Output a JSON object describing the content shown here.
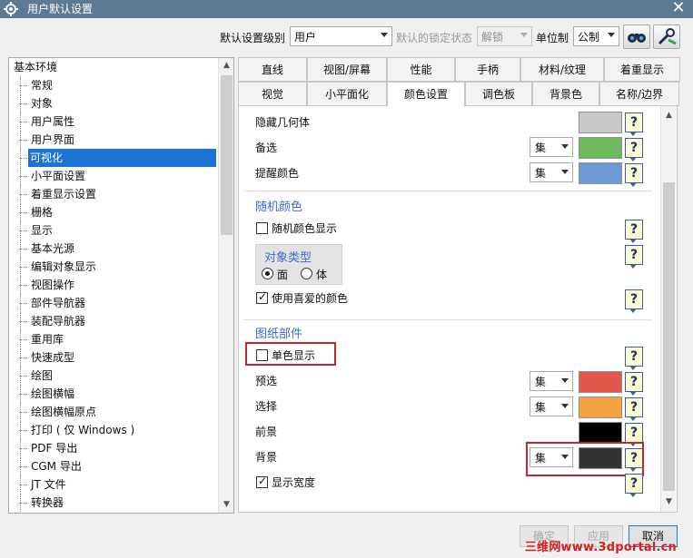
{
  "window": {
    "title": "用户默认设置",
    "close_glyph": "✕"
  },
  "toolbar": {
    "level_label": "默认设置级别",
    "level_value": "用户",
    "lock_label": "默认的锁定状态",
    "lock_value": "解锁",
    "unit_label": "单位制",
    "unit_value": "公制"
  },
  "tree": {
    "root": "基本环境",
    "items": [
      "常规",
      "对象",
      "用户属性",
      "用户界面",
      "可视化",
      "小平面设置",
      "着重显示设置",
      "栅格",
      "显示",
      "基本光源",
      "编辑对象显示",
      "视图操作",
      "部件导航器",
      "装配导航器",
      "重用库",
      "快速成型",
      "绘图",
      "绘图横幅",
      "绘图横幅原点",
      "打印 ( 仅 Windows )",
      "PDF 导出",
      "CGM 导出",
      "JT 文件",
      "转换器"
    ],
    "selected_index": 4
  },
  "tabs": {
    "row1": [
      "直线",
      "视图/屏幕",
      "性能",
      "手柄",
      "材料/纹理",
      "着重显示"
    ],
    "row2": [
      "视觉",
      "小平面化",
      "颜色设置",
      "调色板",
      "背景色",
      "名称/边界"
    ],
    "active": "颜色设置"
  },
  "panel": {
    "hidden_geometry_label": "隐藏几何体",
    "alternate_label": "备选",
    "alternate_mode": "集",
    "reminder_label": "提醒颜色",
    "reminder_mode": "集",
    "random_section_title": "随机颜色",
    "random_display_label": "随机颜色显示",
    "random_display_checked": false,
    "object_type_title": "对象类型",
    "object_type_face": "面",
    "object_type_body": "体",
    "object_type_selected": "面",
    "use_favorite_label": "使用喜爱的颜色",
    "use_favorite_checked": true,
    "drawing_section_title": "图纸部件",
    "monochrome_label": "单色显示",
    "monochrome_checked": false,
    "preselect_label": "预选",
    "preselect_mode": "集",
    "select_label": "选择",
    "select_mode": "集",
    "foreground_label": "前景",
    "background_label": "背景",
    "background_mode": "集",
    "show_width_label": "显示宽度",
    "show_width_checked": true,
    "help_glyph": "?",
    "colors": {
      "hidden_geometry": "#c8c8c8",
      "alternate": "#6cb85c",
      "reminder": "#6b9bd2",
      "preselect": "#e1574c",
      "select": "#f5a243",
      "foreground": "#000000",
      "background": "#333333"
    }
  },
  "buttons": {
    "ok": "确定",
    "apply": "应用",
    "cancel": "取消"
  },
  "watermark": "三维网www.3dportal.cn"
}
